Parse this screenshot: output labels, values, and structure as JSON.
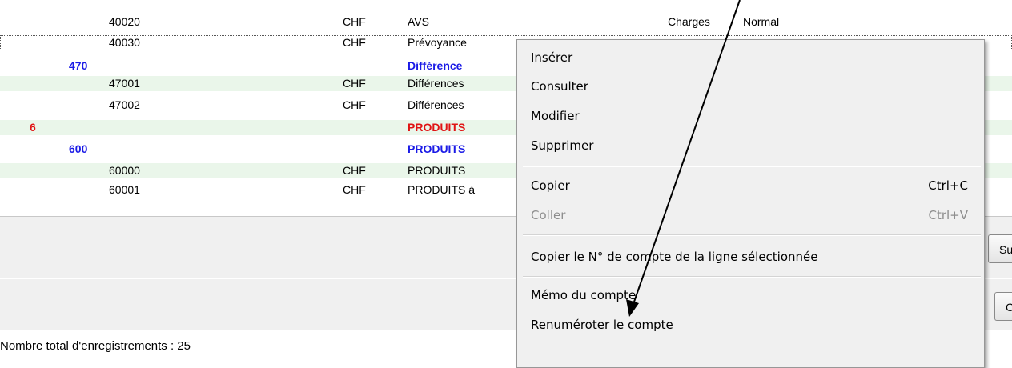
{
  "rows": [
    {
      "code": "40020",
      "currency": "CHF",
      "label": "AVS",
      "type": "Charges",
      "mode": "Normal"
    },
    {
      "code": "40030",
      "currency": "CHF",
      "label": "Prévoyance"
    },
    {
      "code": "470",
      "label": "Différence"
    },
    {
      "code": "47001",
      "currency": "CHF",
      "label": "Différences"
    },
    {
      "code": "47002",
      "currency": "CHF",
      "label": "Différences"
    },
    {
      "code": "6",
      "label": "PRODUITS"
    },
    {
      "code": "600",
      "label": "PRODUITS"
    },
    {
      "code": "60000",
      "currency": "CHF",
      "label": "PRODUITS"
    },
    {
      "code": "60001",
      "currency": "CHF",
      "label": "PRODUITS à"
    }
  ],
  "side_buttons": {
    "top": "Su",
    "bottom": "C"
  },
  "footer": "Nombre total d'enregistrements : 25",
  "menu": {
    "items": [
      {
        "label": "Insérer"
      },
      {
        "label": "Consulter"
      },
      {
        "label": "Modifier"
      },
      {
        "label": "Supprimer"
      },
      {
        "label": "Copier",
        "shortcut": "Ctrl+C"
      },
      {
        "label": "Coller",
        "shortcut": "Ctrl+V",
        "disabled": true
      },
      {
        "label": "Copier le N° de compte de la ligne sélectionnée"
      },
      {
        "label": "Mémo du compte"
      },
      {
        "label": "Renuméroter le compte"
      }
    ]
  },
  "colors": {
    "group_blue": "#1a1ae6",
    "class_red": "#e01414",
    "row_stripe": "#eaf6ea"
  }
}
